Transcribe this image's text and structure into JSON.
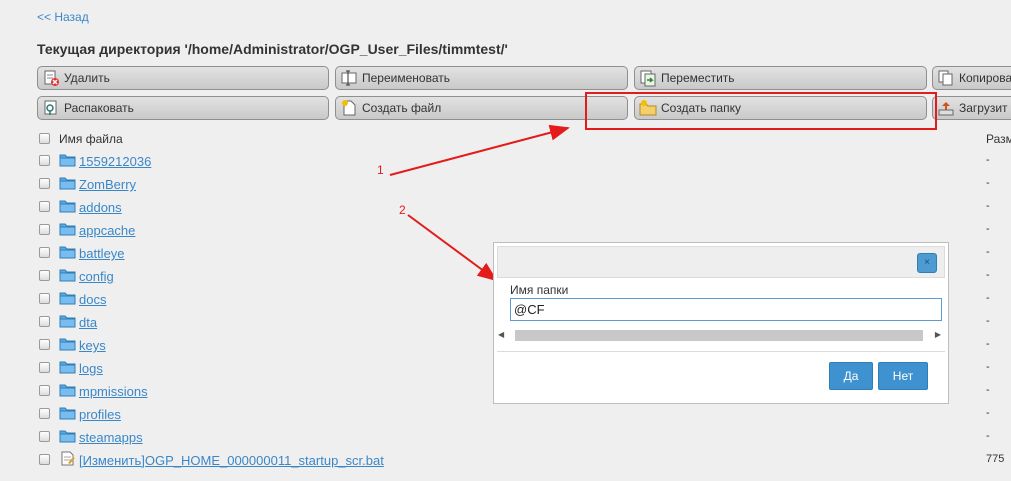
{
  "nav": {
    "back_label": "<< Назад"
  },
  "current_dir": "Текущая директория '/home/Administrator/OGP_User_Files/timmtest/'",
  "toolbar": {
    "row1": [
      {
        "label": "Удалить",
        "icon": "delete-icon"
      },
      {
        "label": "Переименовать",
        "icon": "rename-icon"
      },
      {
        "label": "Переместить",
        "icon": "move-icon"
      },
      {
        "label": "Копирова",
        "icon": "copy-icon"
      }
    ],
    "row2": [
      {
        "label": "Распаковать",
        "icon": "extract-icon"
      },
      {
        "label": "Создать файл",
        "icon": "new-file-icon"
      },
      {
        "label": "Создать папку",
        "icon": "new-folder-icon"
      },
      {
        "label": "Загрузит",
        "icon": "upload-icon"
      }
    ]
  },
  "table": {
    "col_name": "Имя файла",
    "col_size": "Разм",
    "rows": [
      {
        "name": "1559212036",
        "type": "folder",
        "size": "-"
      },
      {
        "name": "ZomBerry",
        "type": "folder",
        "size": "-"
      },
      {
        "name": "addons",
        "type": "folder",
        "size": "-"
      },
      {
        "name": "appcache",
        "type": "folder",
        "size": "-"
      },
      {
        "name": "battleye",
        "type": "folder",
        "size": "-"
      },
      {
        "name": "config",
        "type": "folder",
        "size": "-"
      },
      {
        "name": "docs",
        "type": "folder",
        "size": "-"
      },
      {
        "name": "dta",
        "type": "folder",
        "size": "-"
      },
      {
        "name": "keys",
        "type": "folder",
        "size": "-"
      },
      {
        "name": "logs",
        "type": "folder",
        "size": "-"
      },
      {
        "name": "mpmissions",
        "type": "folder",
        "size": "-"
      },
      {
        "name": "profiles",
        "type": "folder",
        "size": "-"
      },
      {
        "name": "steamapps",
        "type": "folder",
        "size": "-"
      },
      {
        "name": "[Изменить]OGP_HOME_000000011_startup_scr.bat",
        "type": "file",
        "size": "775"
      }
    ]
  },
  "annotations": {
    "label1": "1",
    "label2": "2",
    "color": "#e31b1b"
  },
  "dialog": {
    "close_symbol": "×",
    "field_label": "Имя папки",
    "field_value": "@CF",
    "yes_label": "Да",
    "no_label": "Нет"
  },
  "colors": {
    "link": "#3a87c8",
    "accent": "#3e92cf",
    "annotation": "#e31b1b"
  }
}
